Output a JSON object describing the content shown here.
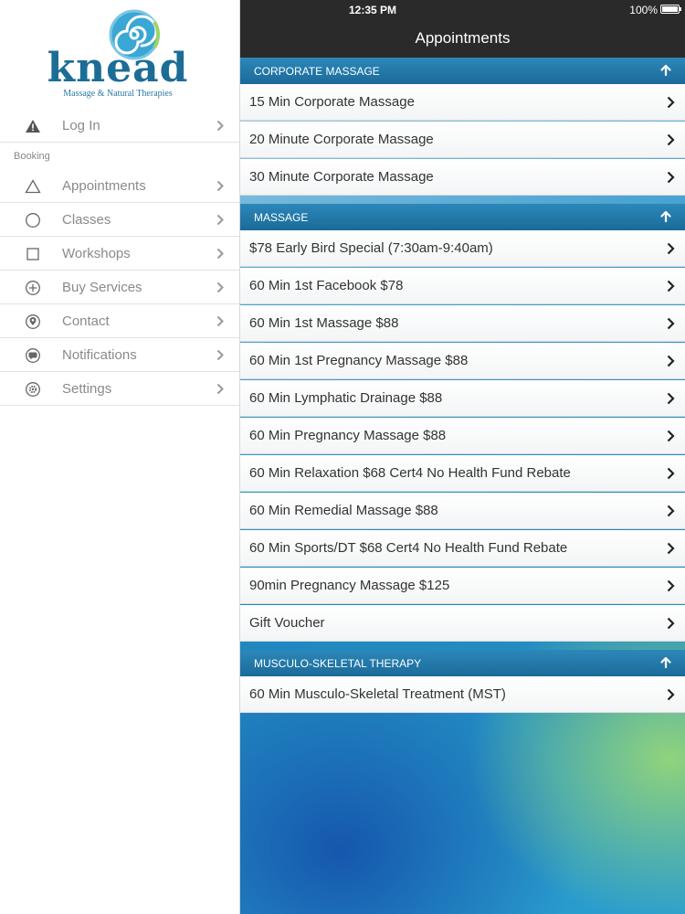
{
  "sidebar": {
    "logo": {
      "brand": "knead",
      "tagline": "Massage & Natural Therapies"
    },
    "login": {
      "label": "Log In",
      "icon": "warning-icon"
    },
    "booking_header": "Booking",
    "items": [
      {
        "label": "Appointments",
        "icon": "triangle-icon"
      },
      {
        "label": "Classes",
        "icon": "circle-icon"
      },
      {
        "label": "Workshops",
        "icon": "square-icon"
      },
      {
        "label": "Buy Services",
        "icon": "plus-circle-icon"
      },
      {
        "label": "Contact",
        "icon": "location-pin-icon"
      },
      {
        "label": "Notifications",
        "icon": "chat-bubble-icon"
      },
      {
        "label": "Settings",
        "icon": "gear-icon"
      }
    ]
  },
  "status_bar": {
    "time": "12:35 PM",
    "battery": "100%"
  },
  "nav": {
    "title": "Appointments"
  },
  "sections": [
    {
      "title": "CORPORATE MASSAGE",
      "items": [
        "15 Min Corporate Massage",
        "20 Minute Corporate Massage",
        "30 Minute Corporate Massage"
      ]
    },
    {
      "title": "MASSAGE",
      "items": [
        "$78 Early Bird Special (7:30am-9:40am)",
        "60 Min 1st Facebook $78",
        "60 Min 1st Massage $88",
        "60 Min 1st Pregnancy Massage $88",
        "60 Min Lymphatic Drainage $88",
        "60 Min Pregnancy Massage $88",
        "60 Min Relaxation $68 Cert4 No Health Fund Rebate",
        "60 Min Remedial Massage $88",
        "60 Min Sports/DT $68 Cert4 No Health Fund Rebate",
        "90min Pregnancy Massage $125",
        "Gift Voucher"
      ]
    },
    {
      "title": "MUSCULO-SKELETAL THERAPY",
      "items": [
        "60 Min Musculo-Skeletal Treatment (MST)"
      ]
    }
  ],
  "colors": {
    "section_header": "#1b6a99",
    "topbar": "#2a2a2a",
    "brand": "#1c6d96"
  }
}
